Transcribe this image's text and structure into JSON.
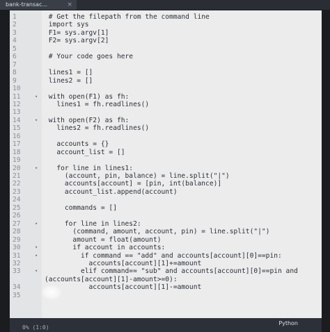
{
  "tab": {
    "title": "bank-transac...",
    "close": "×"
  },
  "editor": {
    "lines": [
      {
        "n": "1",
        "fold": "",
        "code": " # Get the filepath from the command line"
      },
      {
        "n": "2",
        "fold": "",
        "code": " import sys"
      },
      {
        "n": "3",
        "fold": "",
        "code": " F1= sys.argv[1]"
      },
      {
        "n": "4",
        "fold": "",
        "code": " F2= sys.argv[2]"
      },
      {
        "n": "5",
        "fold": "",
        "code": ""
      },
      {
        "n": "6",
        "fold": "",
        "code": " # Your code goes here"
      },
      {
        "n": "7",
        "fold": "",
        "code": ""
      },
      {
        "n": "8",
        "fold": "",
        "code": " lines1 = []"
      },
      {
        "n": "9",
        "fold": "",
        "code": " lines2 = []"
      },
      {
        "n": "10",
        "fold": "",
        "code": ""
      },
      {
        "n": "11",
        "fold": "▾",
        "code": " with open(F1) as fh:"
      },
      {
        "n": "12",
        "fold": "",
        "code": "   lines1 = fh.readlines()"
      },
      {
        "n": "13",
        "fold": "",
        "code": ""
      },
      {
        "n": "14",
        "fold": "▾",
        "code": " with open(F2) as fh:"
      },
      {
        "n": "15",
        "fold": "",
        "code": "   lines2 = fh.readlines()"
      },
      {
        "n": "16",
        "fold": "",
        "code": ""
      },
      {
        "n": "17",
        "fold": "",
        "code": "   accounts = {}"
      },
      {
        "n": "18",
        "fold": "",
        "code": "   account_list = []"
      },
      {
        "n": "19",
        "fold": "",
        "code": ""
      },
      {
        "n": "20",
        "fold": "▾",
        "code": "   for line in lines1:"
      },
      {
        "n": "21",
        "fold": "",
        "code": "     (account, pin, balance) = line.split(\"|\")"
      },
      {
        "n": "22",
        "fold": "",
        "code": "     accounts[account] = [pin, int(balance)]"
      },
      {
        "n": "23",
        "fold": "",
        "code": "     account_list.append(account)"
      },
      {
        "n": "24",
        "fold": "",
        "code": ""
      },
      {
        "n": "25",
        "fold": "",
        "code": "     commands = []"
      },
      {
        "n": "26",
        "fold": "",
        "code": ""
      },
      {
        "n": "27",
        "fold": "▾",
        "code": "     for line in lines2:"
      },
      {
        "n": "28",
        "fold": "",
        "code": "       (command, amount, account, pin) = line.split(\"|\")"
      },
      {
        "n": "29",
        "fold": "",
        "code": "       amount = float(amount)"
      },
      {
        "n": "30",
        "fold": "▾",
        "code": "       if account in accounts:"
      },
      {
        "n": "31",
        "fold": "▾",
        "code": "         if command == \"add\" and accounts[account][0]==pin:"
      },
      {
        "n": "32",
        "fold": "",
        "code": "           accounts[account][1]+=amount"
      },
      {
        "n": "33",
        "fold": "▾",
        "code": "         elif command== \"sub\" and accounts[account][0]==pin and"
      },
      {
        "n": "",
        "fold": "",
        "code": "(accounts[account][1]-amount>=0):"
      },
      {
        "n": "34",
        "fold": "",
        "code": "           accounts[account][1]-=amount"
      },
      {
        "n": "35",
        "fold": "",
        "code": ""
      }
    ]
  },
  "status": {
    "position": "0% (1:0)",
    "language": "Python"
  }
}
